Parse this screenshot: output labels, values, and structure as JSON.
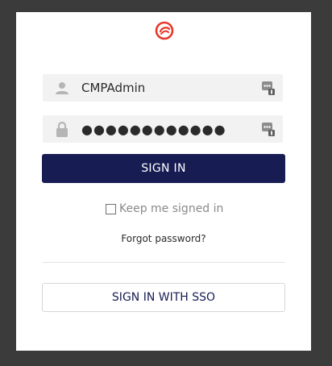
{
  "brand": {
    "logo_icon": "swirl-logo-icon",
    "accent": "#e8382b"
  },
  "login": {
    "username_value": "CMPAdmin",
    "password_value": "●●●●●●●●●●●●",
    "username_icon": "user-icon",
    "password_icon": "lock-icon",
    "password_manager_icon": "password-manager-icon"
  },
  "actions": {
    "sign_in_label": "SIGN IN",
    "keep_signed_in_label": "Keep me signed in",
    "forgot_password_label": "Forgot password?",
    "sso_label": "SIGN IN WITH SSO"
  },
  "colors": {
    "primary": "#171c53",
    "background": "#3b3b3b",
    "field_bg": "#f2f2f2"
  }
}
